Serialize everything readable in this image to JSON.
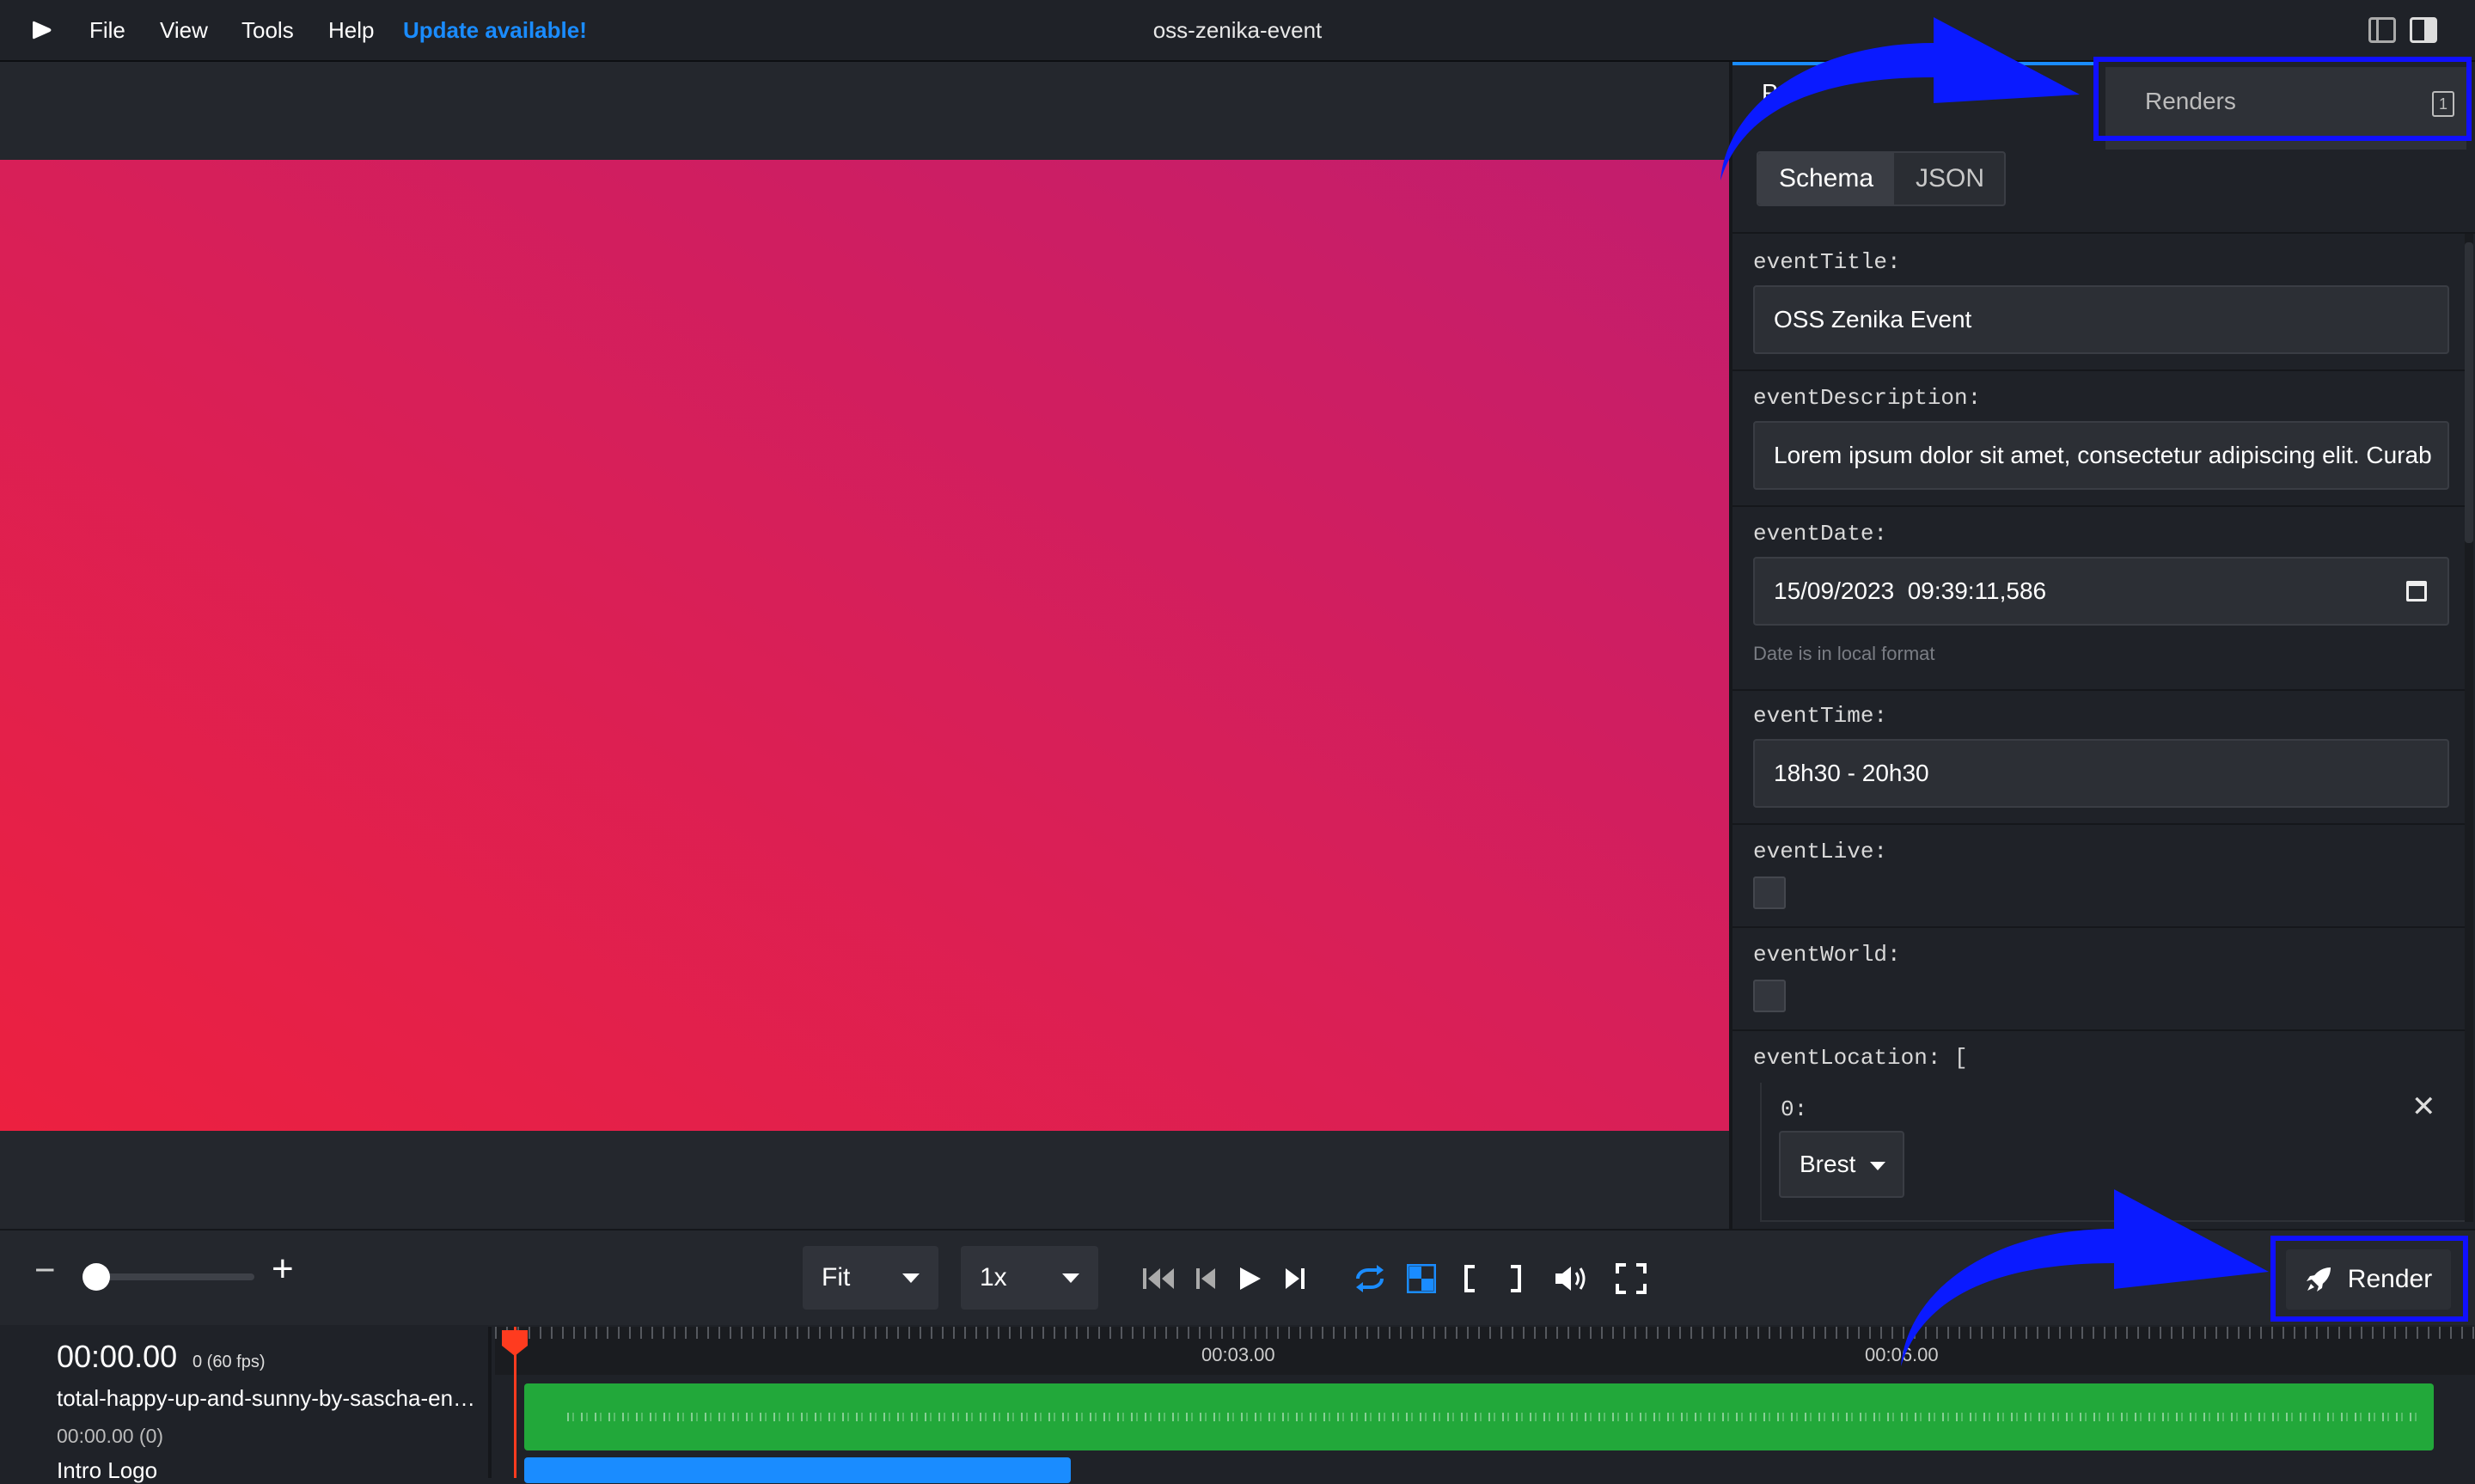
{
  "menubar": {
    "items": [
      "File",
      "View",
      "Tools",
      "Help"
    ],
    "update_label": "Update available!",
    "window_title": "oss-zenika-event"
  },
  "panel": {
    "hidden_tab_letter": "P",
    "renders_tab": "Renders",
    "renders_count": "1",
    "tabs": [
      "Schema",
      "JSON"
    ],
    "fields": {
      "eventTitle": {
        "label": "eventTitle:",
        "value": "OSS Zenika Event"
      },
      "eventDescription": {
        "label": "eventDescription:",
        "value": "Lorem ipsum dolor sit amet, consectetur adipiscing elit. Curab"
      },
      "eventDate": {
        "label": "eventDate:",
        "value": "15/09/2023  09:39:11,586",
        "hint": "Date is in local format"
      },
      "eventTime": {
        "label": "eventTime:",
        "value": "18h30 - 20h30"
      },
      "eventLive": {
        "label": "eventLive:",
        "checked": false
      },
      "eventWorld": {
        "label": "eventWorld:",
        "checked": false
      },
      "eventLocation": {
        "label": "eventLocation: [",
        "item_index": "0:",
        "item_value": "Brest"
      }
    }
  },
  "controls": {
    "zoom_minus": "−",
    "zoom_plus": "+",
    "fit_value": "Fit",
    "rate_value": "1x",
    "render_label": "Render"
  },
  "timeline": {
    "time": "00:00.00",
    "frame": "0 (60 fps)",
    "tracks": [
      {
        "name": "total-happy-up-and-sunny-by-sascha-en…",
        "sub": "00:00.00 (0)"
      },
      {
        "name": "Intro Logo"
      }
    ],
    "ruler_labels": [
      "00:03.00",
      "00:06.00"
    ]
  },
  "colors": {
    "accent": "#1a8cff",
    "audio_track": "#22a83a",
    "video_track": "#1a8cff",
    "playhead": "#ff3b1f",
    "highlight": "#1010ff"
  }
}
